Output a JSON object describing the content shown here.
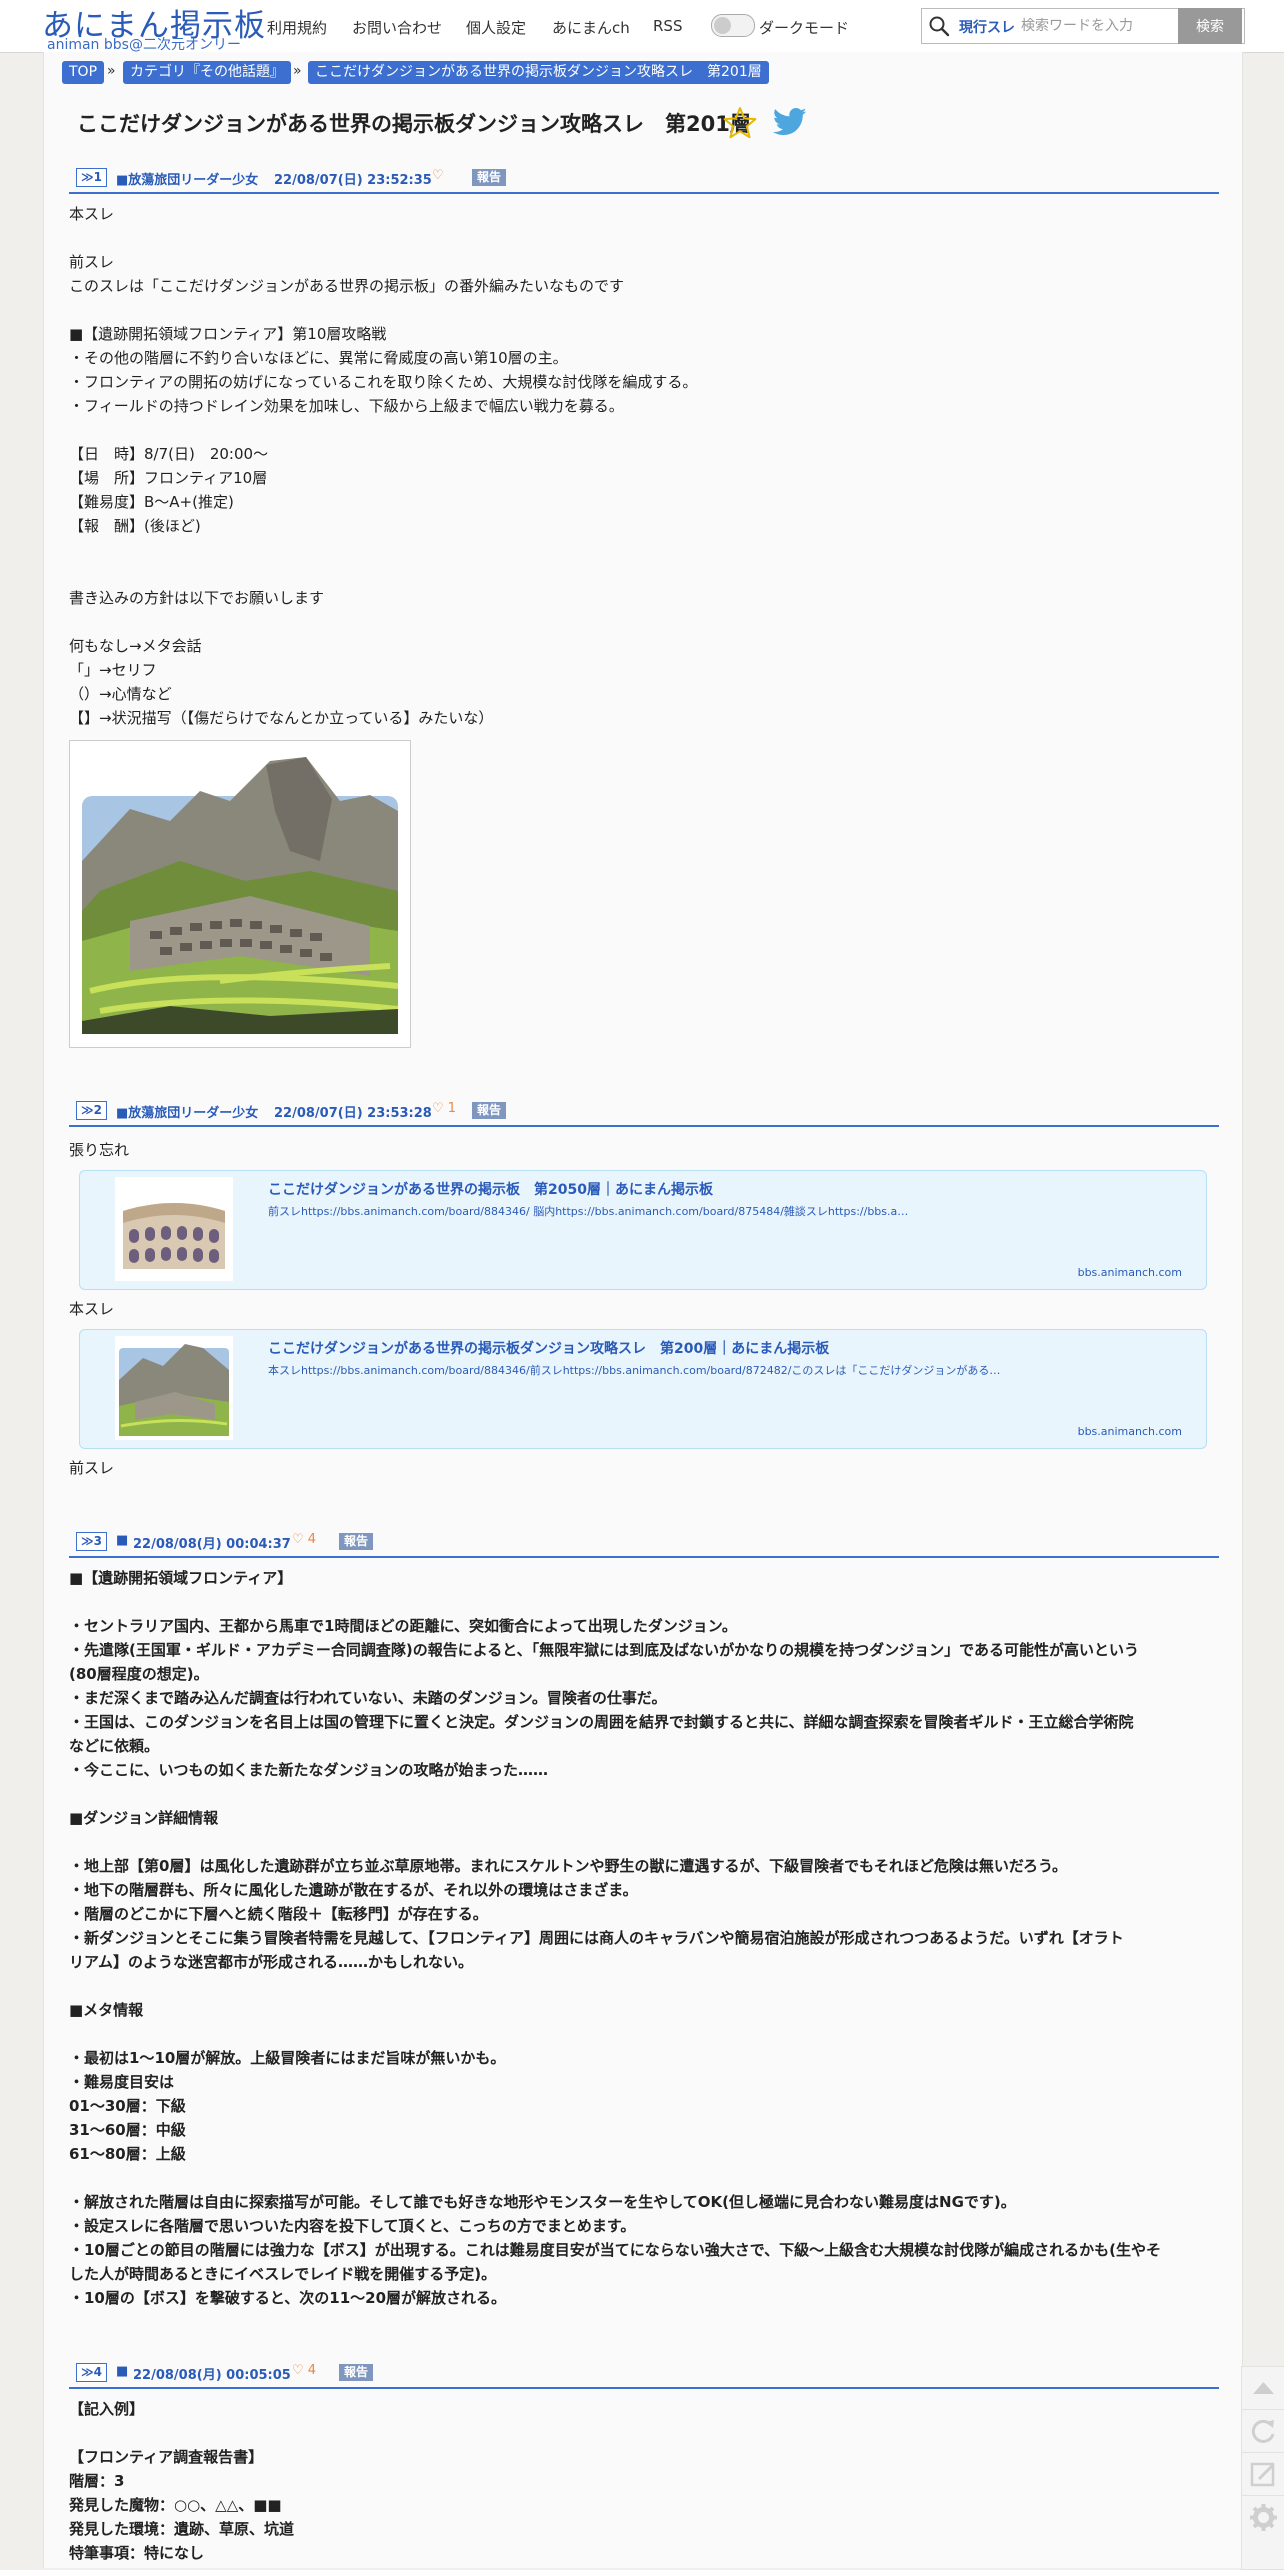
{
  "header": {
    "logo": "あにまん掲示板",
    "logo_sub": "animan bbs@二次元オンリー",
    "nav": [
      "利用規約",
      "お問い合わせ",
      "個人設定",
      "あにまんch",
      "RSS"
    ],
    "dark_mode_label": "ダークモード",
    "search": {
      "scope": "現行スレ",
      "placeholder": "検索ワードを入力",
      "button": "検索"
    }
  },
  "breadcrumb": [
    "TOP",
    "カテゴリ『その他話題』",
    "ここだけダンジョンがある世界の掲示板ダンジョン攻略スレ　第201層"
  ],
  "breadcrumb_sep": "»",
  "page_title": "ここだけダンジョンがある世界の掲示板ダンジョン攻略スレ　第201層",
  "report_label": "報告",
  "posts": [
    {
      "no": "≫1",
      "name": "■放蕩旅団リーダー少女",
      "date": "22/08/07(日) 23:52:35",
      "likes": "",
      "body": "本スレ\n\n前スレ\nこのスレは「ここだけダンジョンがある世界の掲示板」の番外編みたいなものです\n\n■【遺跡開拓領域フロンティア】第10層攻略戦\n・その他の階層に不釣り合いなほどに、異常に脅威度の高い第10層の主。\n・フロンティアの開拓の妨げになっているこれを取り除くため、大規模な討伐隊を編成する。\n・フィールドの持つドレイン効果を加味し、下級から上級まで幅広い戦力を募る。\n\n【日　時】8/7(日)　20:00～\n【場　所】フロンティア10層\n【難易度】B～A+(推定)\n【報　酬】(後ほど)\n\n\n書き込みの方針は以下でお願いします\n\n何もなし→メタ会話\n「」→セリフ\n（）→心情など\n【】→状況描写（【傷だらけでなんとか立っている】みたいな）"
    },
    {
      "no": "≫2",
      "name": "■放蕩旅団リーダー少女",
      "date": "22/08/07(日) 23:53:28",
      "likes": "1",
      "line1": "張り忘れ",
      "line2": "本スレ",
      "line3": "前スレ",
      "cards": [
        {
          "title": "ここだけダンジョンがある世界の掲示板　第2050層｜あにまん掲示板",
          "desc": "前スレhttps://bbs.animanch.com/board/884346/ 脳内https://bbs.animanch.com/board/875484/雑談スレhttps://bbs.a…",
          "domain": "bbs.animanch.com"
        },
        {
          "title": "ここだけダンジョンがある世界の掲示板ダンジョン攻略スレ　第200層｜あにまん掲示板",
          "desc": "本スレhttps://bbs.animanch.com/board/884346/前スレhttps://bbs.animanch.com/board/872482/このスレは「ここだけダンジョンがある…",
          "domain": "bbs.animanch.com"
        }
      ]
    },
    {
      "no": "≫3",
      "name": "■",
      "date": "22/08/08(月) 00:04:37",
      "likes": "4",
      "body": "■【遺跡開拓領域フロンティア】\n\n・セントラリア国内、王都から馬車で1時間ほどの距離に、突如衝合によって出現したダンジョン。\n・先遣隊(王国軍・ギルド・アカデミー合同調査隊)の報告によると、「無限牢獄には到底及ばないがかなりの規模を持つダンジョン」である可能性が高いという\n(80層程度の想定)。\n・まだ深くまで踏み込んだ調査は行われていない、未踏のダンジョン。冒険者の仕事だ。\n・王国は、このダンジョンを名目上は国の管理下に置くと決定。ダンジョンの周囲を結界で封鎖すると共に、詳細な調査探索を冒険者ギルド・王立総合学術院\nなどに依頼。\n・今ここに、いつもの如くまた新たなダンジョンの攻略が始まった……\n\n■ダンジョン詳細情報\n\n・地上部【第0層】は風化した遺跡群が立ち並ぶ草原地帯。まれにスケルトンや野生の獣に遭遇するが、下級冒険者でもそれほど危険は無いだろう。\n・地下の階層群も、所々に風化した遺跡が散在するが、それ以外の環境はさまざま。\n・階層のどこかに下層へと続く階段＋【転移門】が存在する。\n・新ダンジョンとそこに集う冒険者特需を見越して、【フロンティア】周囲には商人のキャラバンや簡易宿泊施設が形成されつつあるようだ。いずれ【オラト\nリアム】のような迷宮都市が形成される……かもしれない。\n\n■メタ情報\n\n・最初は1～10層が解放。上級冒険者にはまだ旨味が無いかも。\n・難易度目安は\n01～30層：下級\n31～60層：中級\n61～80層：上級\n\n・解放された階層は自由に探索描写が可能。そして誰でも好きな地形やモンスターを生やしてOK(但し極端に見合わない難易度はNGです)。\n・設定スレに各階層で思いついた内容を投下して頂くと、こっちの方でまとめます。\n・10層ごとの節目の階層には強力な【ボス】が出現する。これは難易度目安が当てにならない強大さで、下級～上級含む大規模な討伐隊が編成されるかも(生やそ\nした人が時間あるときにイベスレでレイド戦を開催する予定)。\n・10層の【ボス】を撃破すると、次の11～20層が解放される。"
    },
    {
      "no": "≫4",
      "name": "■",
      "date": "22/08/08(月) 00:05:05",
      "likes": "4",
      "body": "【記入例】\n\n【フロンティア調査報告書】\n階層：3\n発見した魔物：○○、△△、■■\n発見した環境：遺跡、草原、坑道\n特筆事項：特になし"
    }
  ]
}
